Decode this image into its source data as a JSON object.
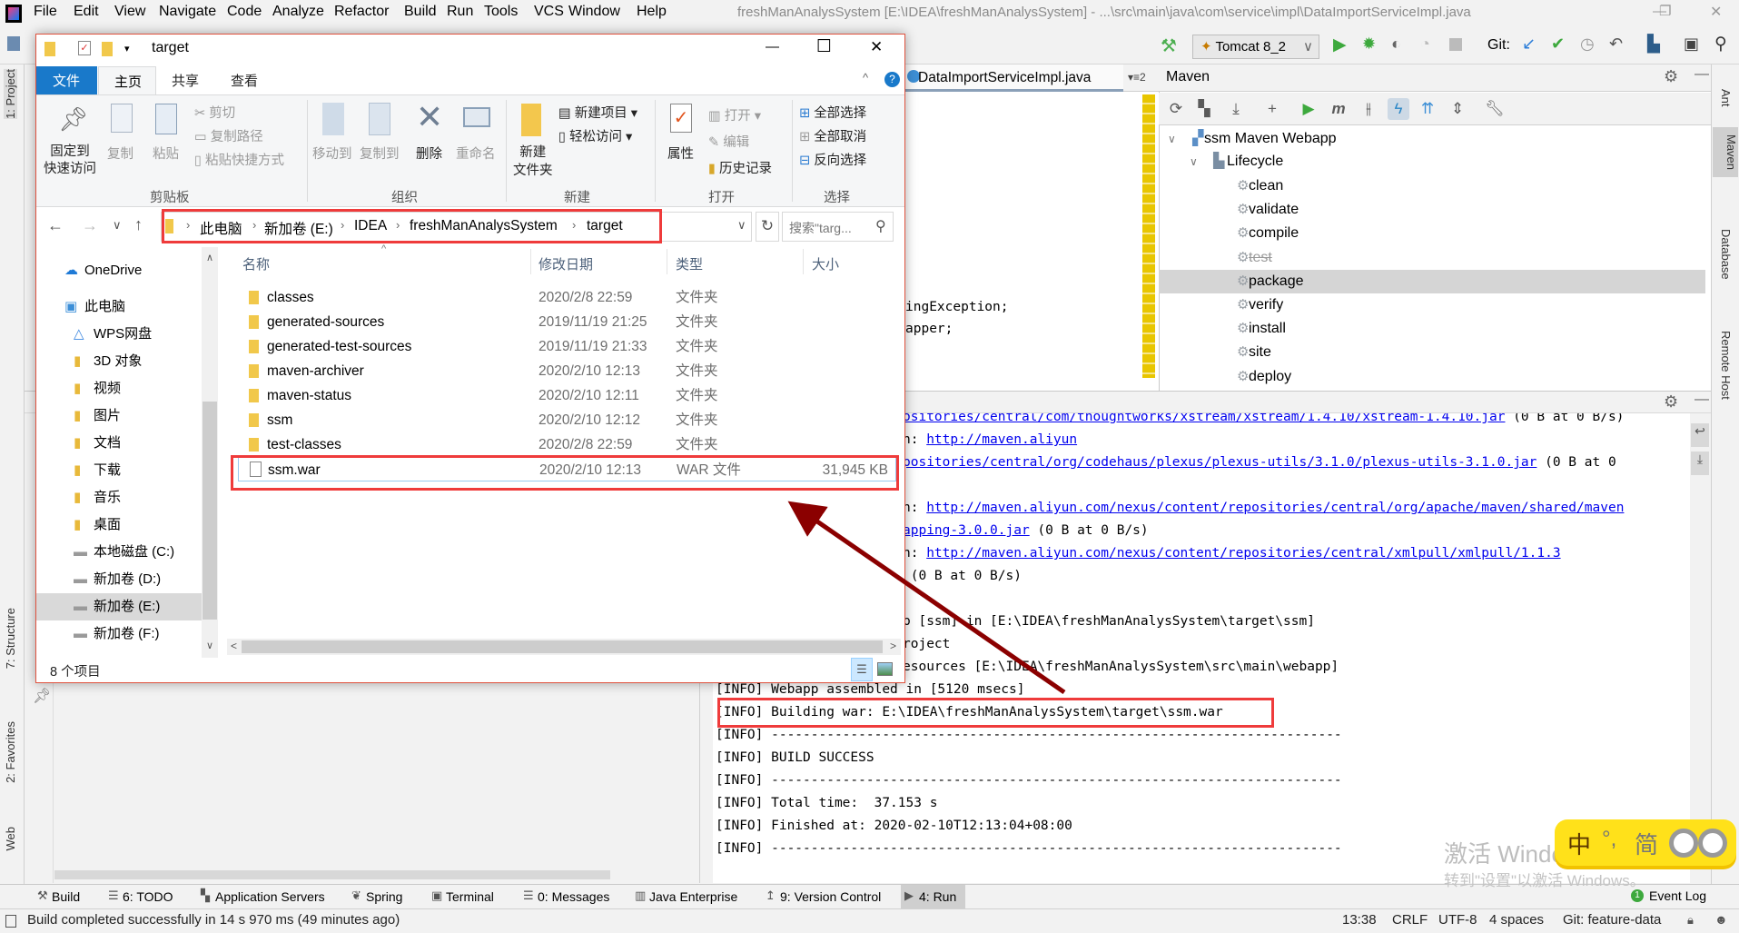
{
  "ide": {
    "menu": [
      "File",
      "Edit",
      "View",
      "Navigate",
      "Code",
      "Analyze",
      "Refactor",
      "Build",
      "Run",
      "Tools",
      "VCS",
      "Window",
      "Help"
    ],
    "window_title": "freshManAnalysSystem [E:\\IDEA\\freshManAnalysSystem] - ...\\src\\main\\java\\com\\service\\impl\\DataImportServiceImpl.java",
    "window_controls": {
      "minimize": "—",
      "restore": "❐",
      "close": "✕"
    },
    "run_config": "Tomcat 8_2",
    "git_label": "Git:",
    "left_strip": [
      "1: Project",
      "7: Structure",
      "2: Favorites",
      "Web"
    ],
    "right_strip": [
      "Ant",
      "Maven",
      "Database",
      "Remote Host"
    ]
  },
  "editor": {
    "tab": "DataImportServiceImpl.java",
    "tab_count": "2",
    "code_lines": [
      "ingException;",
      "apper;"
    ]
  },
  "maven": {
    "title": "Maven",
    "project": "ssm Maven Webapp",
    "lifecycle": "Lifecycle",
    "goals": [
      "clean",
      "validate",
      "compile",
      "test",
      "package",
      "verify",
      "install",
      "site",
      "deploy"
    ],
    "selected_goal": "package",
    "disabled_goal": "test"
  },
  "console": {
    "lines": [
      {
        "pre": "",
        "link": "ositories/central/com/thoughtworks/xstream/xstream/1.4.10/xstream-1.4.10.jar",
        "post": " (0 B at 0 B/s)",
        "full": false
      },
      {
        "pre": "n: ",
        "link": "http://maven.aliyun",
        "post": "",
        "full": false
      },
      {
        "pre": "",
        "link": "positories/central/org/codehaus/plexus/plexus-utils/3.1.0/plexus-utils-3.1.0.jar",
        "post": " (0 B at 0",
        "full": false
      },
      {
        "pre": "",
        "link": "",
        "post": "",
        "full": false
      },
      {
        "pre": "n: ",
        "link": "http://maven.aliyun.com/nexus/content/repositories/central/org/apache/maven/shared/maven",
        "post": "",
        "full": false
      },
      {
        "pre": "",
        "link": "apping-3.0.0.jar",
        "post": " (0 B at 0 B/s)",
        "full": false
      },
      {
        "pre": "n: ",
        "link": "http://maven.aliyun.com/nexus/content/repositories/central/xmlpull/xmlpull/1.1.3",
        "post": "",
        "full": false
      },
      {
        "pre": " (0 B at 0 B/s)",
        "link": "",
        "post": "",
        "full": false
      },
      {
        "pre": "",
        "link": "",
        "post": "",
        "full": false
      },
      {
        "pre": "p [ssm] in [E:\\IDEA\\freshManAnalysSystem\\target\\ssm]",
        "link": "",
        "post": "",
        "full": false
      },
      {
        "pre": "roject",
        "link": "",
        "post": "",
        "full": false
      },
      {
        "pre": "esources [E:\\IDEA\\freshManAnalysSystem\\src\\main\\webapp]",
        "link": "",
        "post": "",
        "full": false
      },
      {
        "pre": "[INFO] Webapp assembled in [5120 msecs]",
        "link": "",
        "post": "",
        "full": true
      },
      {
        "pre": "[INFO] Building war: E:\\IDEA\\freshManAnalysSystem\\target\\ssm.war",
        "link": "",
        "post": "",
        "full": true
      },
      {
        "pre": "[INFO] ------------------------------------------------------------------------",
        "link": "",
        "post": "",
        "full": true
      },
      {
        "pre": "[INFO] BUILD SUCCESS",
        "link": "",
        "post": "",
        "full": true
      },
      {
        "pre": "[INFO] ------------------------------------------------------------------------",
        "link": "",
        "post": "",
        "full": true
      },
      {
        "pre": "[INFO] Total time:  37.153 s",
        "link": "",
        "post": "",
        "full": true
      },
      {
        "pre": "[INFO] Finished at: 2020-02-10T12:13:04+08:00",
        "link": "",
        "post": "",
        "full": true
      },
      {
        "pre": "[INFO] ------------------------------------------------------------------------",
        "link": "",
        "post": "",
        "full": true
      }
    ]
  },
  "explorer": {
    "title": "target",
    "controls": {
      "minimize": "—",
      "maximize": "☐",
      "close": "✕"
    },
    "tabs": [
      "文件",
      "主页",
      "共享",
      "查看"
    ],
    "active_tab": "主页",
    "help": "?",
    "ribbon": {
      "pin": [
        "固定到",
        "快速访问"
      ],
      "copy": "复制",
      "paste": "粘贴",
      "cut": "剪切",
      "copy_path": "复制路径",
      "paste_shortcut": "粘贴快捷方式",
      "move_to": "移动到",
      "copy_to": "复制到",
      "delete": "删除",
      "rename": "重命名",
      "new_folder": [
        "新建",
        "文件夹"
      ],
      "new_item": "新建项目 ▾",
      "easy_access": "轻松访问 ▾",
      "properties": "属性",
      "open": "打开 ▾",
      "edit": "编辑",
      "history": "历史记录",
      "select_all": "全部选择",
      "select_none": "全部取消",
      "invert_selection": "反向选择",
      "groups": [
        "剪贴板",
        "组织",
        "新建",
        "打开",
        "选择"
      ]
    },
    "breadcrumb": [
      "此电脑",
      "新加卷 (E:)",
      "IDEA",
      "freshManAnalysSystem",
      "target"
    ],
    "search_placeholder": "搜索\"targ...",
    "nav": [
      {
        "label": "OneDrive",
        "icon": "onedrive-icon"
      },
      {
        "label": "此电脑",
        "icon": "computer-icon"
      },
      {
        "label": "WPS网盘",
        "icon": "cloud-icon"
      },
      {
        "label": "3D 对象",
        "icon": "folder-3d-icon"
      },
      {
        "label": "视频",
        "icon": "folder-video-icon"
      },
      {
        "label": "图片",
        "icon": "folder-pictures-icon"
      },
      {
        "label": "文档",
        "icon": "folder-documents-icon"
      },
      {
        "label": "下载",
        "icon": "folder-downloads-icon"
      },
      {
        "label": "音乐",
        "icon": "folder-music-icon"
      },
      {
        "label": "桌面",
        "icon": "folder-desktop-icon"
      },
      {
        "label": "本地磁盘 (C:)",
        "icon": "drive-icon"
      },
      {
        "label": "新加卷 (D:)",
        "icon": "drive-icon"
      },
      {
        "label": "新加卷 (E:)",
        "icon": "drive-icon"
      },
      {
        "label": "新加卷 (F:)",
        "icon": "drive-icon"
      }
    ],
    "nav_selected": "新加卷 (E:)",
    "columns": [
      "名称",
      "修改日期",
      "类型",
      "大小"
    ],
    "files": [
      {
        "name": "classes",
        "date": "2020/2/8 22:59",
        "type": "文件夹",
        "size": "",
        "kind": "folder"
      },
      {
        "name": "generated-sources",
        "date": "2019/11/19 21:25",
        "type": "文件夹",
        "size": "",
        "kind": "folder"
      },
      {
        "name": "generated-test-sources",
        "date": "2019/11/19 21:33",
        "type": "文件夹",
        "size": "",
        "kind": "folder"
      },
      {
        "name": "maven-archiver",
        "date": "2020/2/10 12:13",
        "type": "文件夹",
        "size": "",
        "kind": "folder"
      },
      {
        "name": "maven-status",
        "date": "2020/2/10 12:11",
        "type": "文件夹",
        "size": "",
        "kind": "folder"
      },
      {
        "name": "ssm",
        "date": "2020/2/10 12:12",
        "type": "文件夹",
        "size": "",
        "kind": "folder"
      },
      {
        "name": "test-classes",
        "date": "2020/2/8 22:59",
        "type": "文件夹",
        "size": "",
        "kind": "folder"
      },
      {
        "name": "ssm.war",
        "date": "2020/2/10 12:13",
        "type": "WAR 文件",
        "size": "31,945 KB",
        "kind": "file"
      }
    ],
    "status": "8 个项目"
  },
  "bottom_tools": [
    "Build",
    "6: TODO",
    "Application Servers",
    "Spring",
    "Terminal",
    "0: Messages",
    "Java Enterprise",
    "9: Version Control",
    "4: Run"
  ],
  "active_tool": "4: Run",
  "event_log": {
    "badge": "1",
    "label": "Event Log"
  },
  "status": {
    "message": "Build completed successfully in 14 s 970 ms (49 minutes ago)",
    "position": "13:38",
    "line_sep": "CRLF",
    "encoding": "UTF-8",
    "indent": "4 spaces",
    "vcs": "Git: feature-data"
  },
  "watermark": {
    "line1": "激活 Windows",
    "line2": "转到\"设置\"以激活 Windows。"
  },
  "ime": {
    "mode": "中",
    "punct": "°,",
    "script": "简"
  },
  "colors": {
    "annotation_red": "#ef3b3b",
    "arrow": "#8b0000",
    "link": "#0000ee",
    "explorer_file_tab": "#1979ca",
    "ime_yellow": "#ffe11a"
  }
}
